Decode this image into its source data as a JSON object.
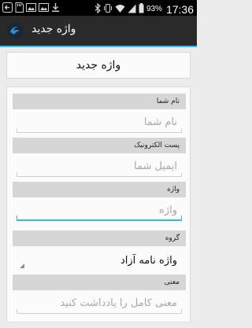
{
  "status_bar": {
    "battery_percent": "93%",
    "time": "17:36",
    "icons": [
      "back-arrow-icon",
      "sd-card-icon",
      "image-icon",
      "image-icon",
      "download-icon",
      "bluetooth-icon",
      "vibrate-icon",
      "wifi-icon",
      "signal-icon",
      "battery-icon"
    ]
  },
  "action_bar": {
    "title": "واژه جدید",
    "app_icon": "app-logo-icon"
  },
  "header": {
    "title": "واژه جدید"
  },
  "form": {
    "name": {
      "label": "نام شما",
      "placeholder": "نام شما"
    },
    "email": {
      "label": "پست الکترونیک",
      "placeholder": "ایمیل شما"
    },
    "word": {
      "label": "واژه",
      "placeholder": "واژه"
    },
    "group": {
      "label": "گروه",
      "selected": "واژه نامه آزاد"
    },
    "meaning": {
      "label": "معنی",
      "placeholder": "معنی کامل را یادداشت کنید"
    }
  },
  "colors": {
    "accent": "#33b5e5",
    "action_bar": "#2a2a2a",
    "section_label_bg": "#d6d6d6"
  }
}
